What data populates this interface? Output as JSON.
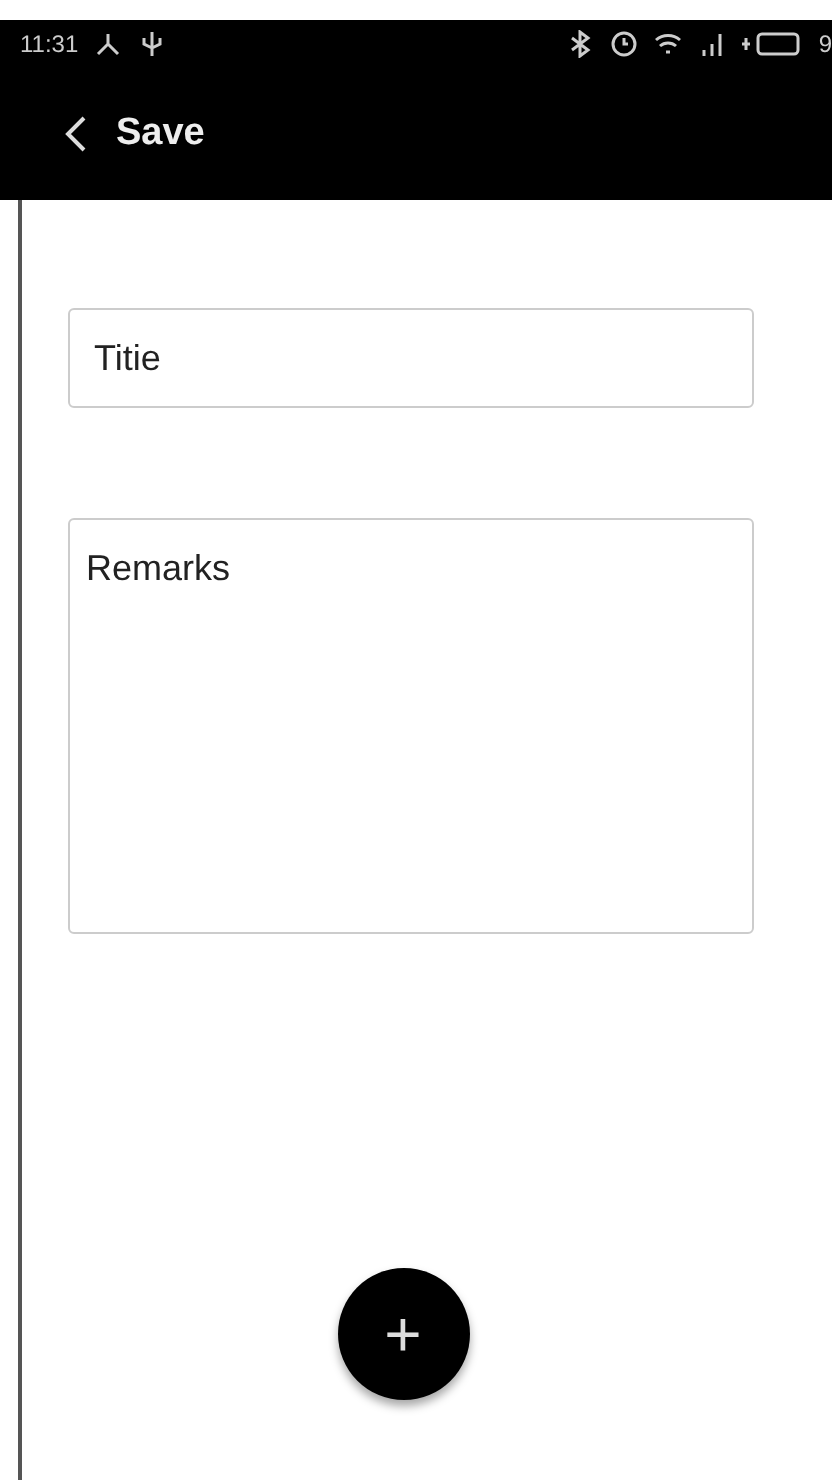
{
  "status_bar": {
    "time": "11:31",
    "battery": "9"
  },
  "app_bar": {
    "title": "Save"
  },
  "title_field": {
    "placeholder": "Titie"
  },
  "remarks_field": {
    "placeholder": "Remarks"
  },
  "fab": {
    "label": "+"
  }
}
